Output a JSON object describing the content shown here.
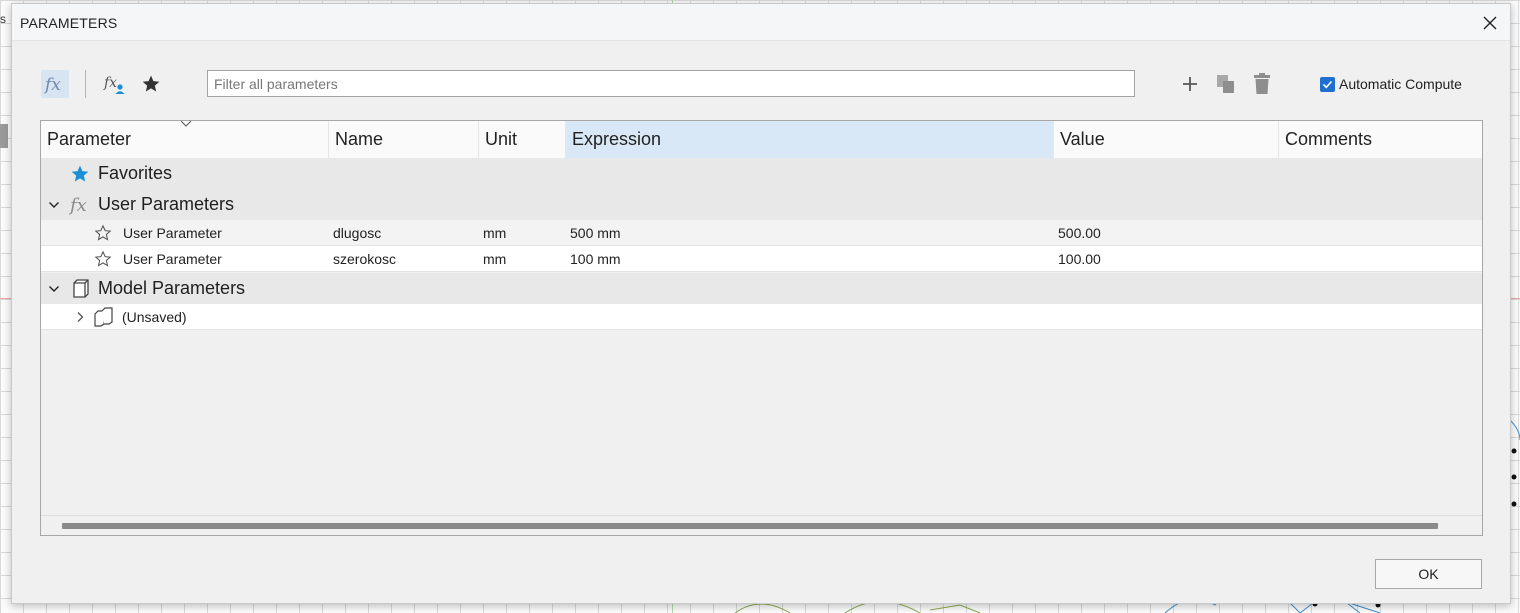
{
  "window": {
    "title": "PARAMETERS",
    "ok_label": "OK"
  },
  "toolbar": {
    "filter_placeholder": "Filter all parameters",
    "auto_compute_label": "Automatic Compute",
    "auto_compute_checked": true
  },
  "columns": [
    "Parameter",
    "Name",
    "Unit",
    "Expression",
    "Value",
    "Comments"
  ],
  "groups": {
    "favorites": "Favorites",
    "user": "User Parameters",
    "model": "Model Parameters"
  },
  "user_parameters": [
    {
      "parameter": "User Parameter",
      "name": "dlugosc",
      "unit": "mm",
      "expression": "500 mm",
      "value": "500.00",
      "comments": ""
    },
    {
      "parameter": "User Parameter",
      "name": "szerokosc",
      "unit": "mm",
      "expression": "100 mm",
      "value": "100.00",
      "comments": ""
    }
  ],
  "model_children": [
    {
      "label": "(Unsaved)"
    }
  ],
  "accent_color": "#1e6fd0",
  "favorite_color": "#1a8fd6"
}
